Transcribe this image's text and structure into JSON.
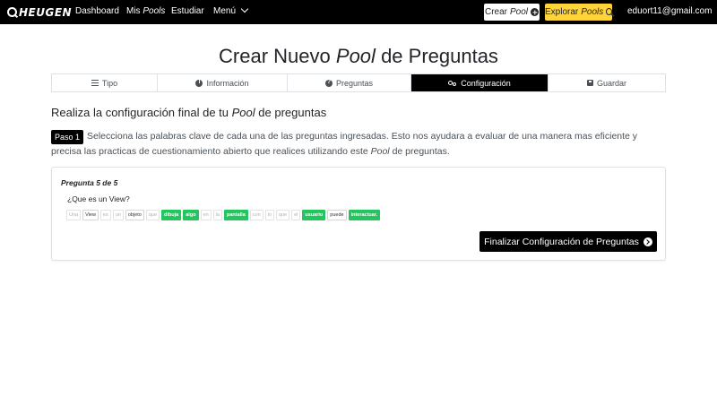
{
  "navbar": {
    "brand": "HEUGEN",
    "links": {
      "dashboard": "Dashboard",
      "mis_prefix": "Mis",
      "mis_pools": "Pools",
      "estudiar": "Estudiar",
      "menu": "Menú"
    },
    "create_prefix": "Crear",
    "create_pool": "Pool",
    "explore_prefix": "Explorar",
    "explore_pools": "Pools",
    "user_email": "eduort11@gmail.com",
    "explore_color": "#ffd43b"
  },
  "page": {
    "title_a": "Crear Nuevo",
    "title_b": "Pool",
    "title_c": "de Preguntas"
  },
  "steps": [
    {
      "label": "Tipo",
      "icon": "list-icon"
    },
    {
      "label": "Información",
      "icon": "info-icon"
    },
    {
      "label": "Preguntas",
      "icon": "question-icon"
    },
    {
      "label": "Configuración",
      "icon": "cogs-icon",
      "active": true
    },
    {
      "label": "Guardar",
      "icon": "save-icon"
    }
  ],
  "config": {
    "subtitle_a": "Realiza la configuración final de tu",
    "subtitle_b": "Pool",
    "subtitle_c": "de preguntas",
    "paso": "Paso 1",
    "instr_a": "Selecciona las palabras clave de cada una de las preguntas ingresadas. Esto nos ayudara a evaluar de una manera mas eficiente y precisa las practicas de cuestionamiento abierto que realices utilizando este",
    "instr_b": "Pool",
    "instr_c": "de preguntas."
  },
  "question": {
    "heading": "Pregunta 5 de 5",
    "text": "¿Que es un View?",
    "words": [
      {
        "text": "Una",
        "state": "off"
      },
      {
        "text": "View",
        "state": "mid"
      },
      {
        "text": "es",
        "state": "off"
      },
      {
        "text": "un",
        "state": "off"
      },
      {
        "text": "objeto",
        "state": "mid"
      },
      {
        "text": "que",
        "state": "off"
      },
      {
        "text": "dibuja",
        "state": "on"
      },
      {
        "text": "algo",
        "state": "on"
      },
      {
        "text": "en",
        "state": "off"
      },
      {
        "text": "la",
        "state": "off"
      },
      {
        "text": "pantalla",
        "state": "on"
      },
      {
        "text": "con",
        "state": "off"
      },
      {
        "text": "lo",
        "state": "off"
      },
      {
        "text": "que",
        "state": "off"
      },
      {
        "text": "el",
        "state": "off"
      },
      {
        "text": "usuario",
        "state": "on"
      },
      {
        "text": "puede",
        "state": "mid"
      },
      {
        "text": "interactuar.",
        "state": "on"
      }
    ],
    "selected_color": "#22c55e",
    "finish_button": "Finalizar Configuración de Preguntas"
  }
}
